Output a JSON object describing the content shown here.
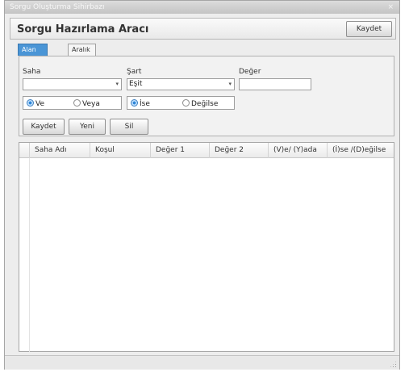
{
  "window": {
    "title": "Sorgu Oluşturma Sihirbazı",
    "close_glyph": "×"
  },
  "header": {
    "title": "Sorgu Hazırlama Aracı",
    "save_label": "Kaydet"
  },
  "tabs": [
    {
      "label": "Alan Seçimi",
      "active": true
    },
    {
      "label": "Aralık Maske",
      "active": false
    }
  ],
  "form": {
    "field_label": "Saha",
    "field_value": "",
    "condition_label": "Şart",
    "condition_value": "Eşit",
    "value_label": "Değer",
    "value_value": "",
    "dropdown_arrow": "▾",
    "logic_group": [
      {
        "label": "Ve",
        "selected": true
      },
      {
        "label": "Veya",
        "selected": false
      }
    ],
    "ifelse_group": [
      {
        "label": "İse",
        "selected": true
      },
      {
        "label": "Değilse",
        "selected": false
      }
    ],
    "buttons": {
      "save": "Kaydet",
      "new": "Yeni",
      "delete": "Sil"
    }
  },
  "table": {
    "columns": [
      "Saha Adı",
      "Koşul",
      "Değer 1",
      "Değer 2",
      "(V)e/ (Y)ada",
      "(İ)se /(D)eğilse"
    ],
    "rows": []
  },
  "colors": {
    "accent": "#4a95d6",
    "window_bg": "#ededed"
  }
}
